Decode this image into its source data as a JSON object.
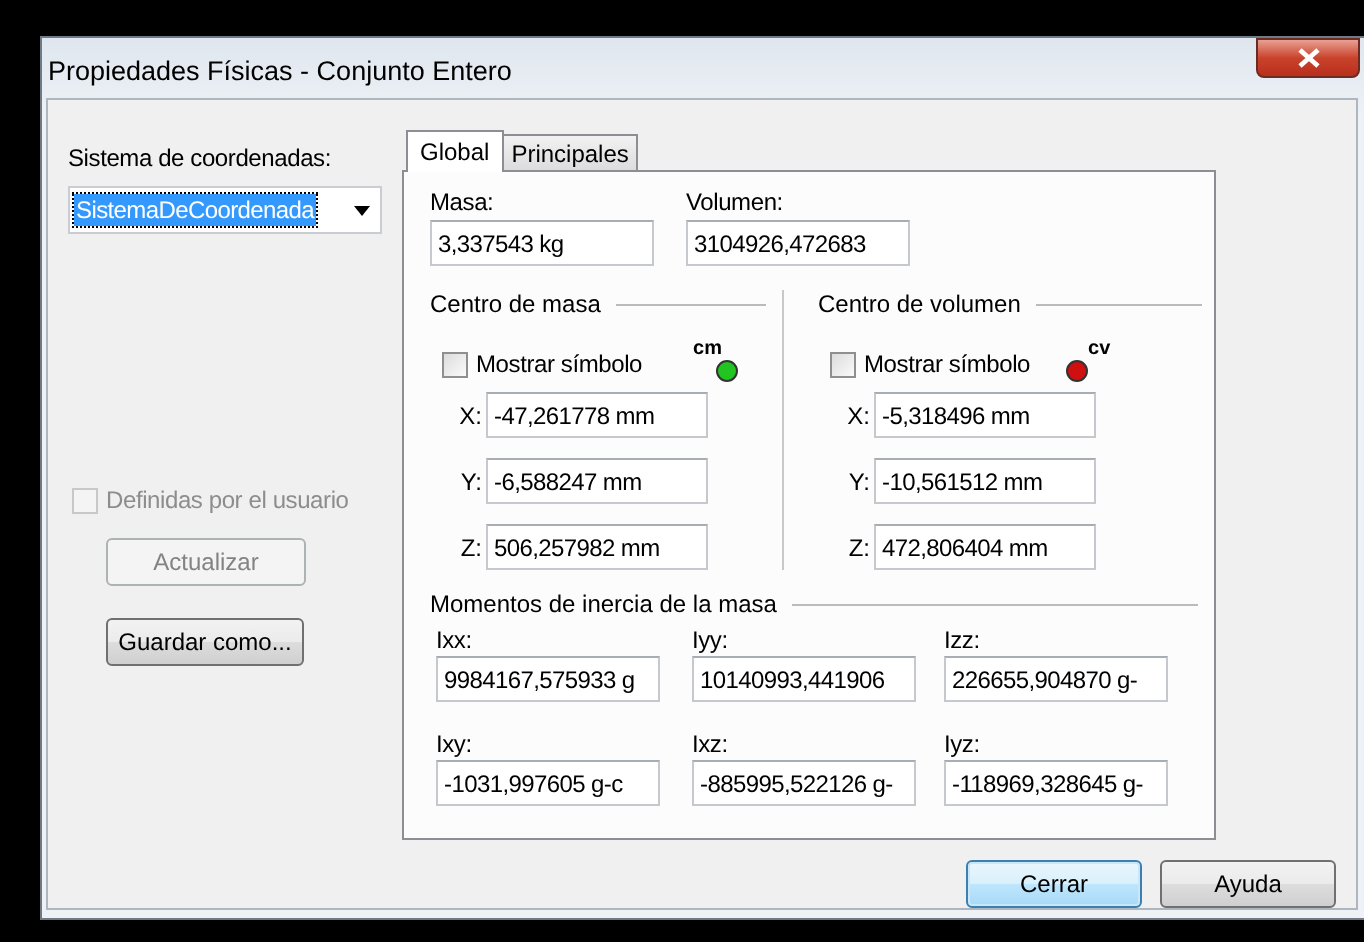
{
  "window": {
    "title": "Propiedades Físicas - Conjunto Entero"
  },
  "coordinate_system": {
    "label": "Sistema de coordenadas:",
    "value": "SistemaDeCoordenada",
    "selected": true
  },
  "user_defined": {
    "label": "Definidas por el usuario",
    "checked": false,
    "disabled": true
  },
  "side_buttons": [
    {
      "label": "Actualizar",
      "disabled": true
    },
    {
      "label": "Guardar como...",
      "disabled": false
    }
  ],
  "tabs": [
    {
      "label": "Global",
      "selected": true
    },
    {
      "label": "Principales",
      "selected": false
    }
  ],
  "mass": {
    "label": "Masa:",
    "value": "3,337543 kg"
  },
  "volume": {
    "label": "Volumen:",
    "value": "3104926,472683"
  },
  "centers": [
    {
      "title": "Centro de masa",
      "show_symbol": {
        "label": "Mostrar símbolo",
        "checked": false
      },
      "symbol": {
        "label": "cm",
        "color": "#22c422"
      },
      "coords": [
        {
          "axis": "X:",
          "value": "-47,261778 mm"
        },
        {
          "axis": "Y:",
          "value": "-6,588247 mm"
        },
        {
          "axis": "Z:",
          "value": "506,257982 mm"
        }
      ]
    },
    {
      "title": "Centro de volumen",
      "show_symbol": {
        "label": "Mostrar símbolo",
        "checked": false
      },
      "symbol": {
        "label": "cv",
        "color": "#d01010"
      },
      "coords": [
        {
          "axis": "X:",
          "value": "-5,318496 mm"
        },
        {
          "axis": "Y:",
          "value": "-10,561512 mm"
        },
        {
          "axis": "Z:",
          "value": "472,806404 mm"
        }
      ]
    }
  ],
  "inertia": {
    "title": "Momentos de inercia de la masa",
    "items": [
      {
        "label": "Ixx:",
        "value": "9984167,575933 g"
      },
      {
        "label": "Iyy:",
        "value": "10140993,441906"
      },
      {
        "label": "Izz:",
        "value": "226655,904870 g-"
      },
      {
        "label": "Ixy:",
        "value": "-1031,997605 g-c"
      },
      {
        "label": "Ixz:",
        "value": "-885995,522126 g-"
      },
      {
        "label": "Iyz:",
        "value": "-118969,328645 g-"
      }
    ]
  },
  "dialog_buttons": [
    {
      "label": "Cerrar",
      "default": true
    },
    {
      "label": "Ayuda",
      "default": false
    }
  ]
}
